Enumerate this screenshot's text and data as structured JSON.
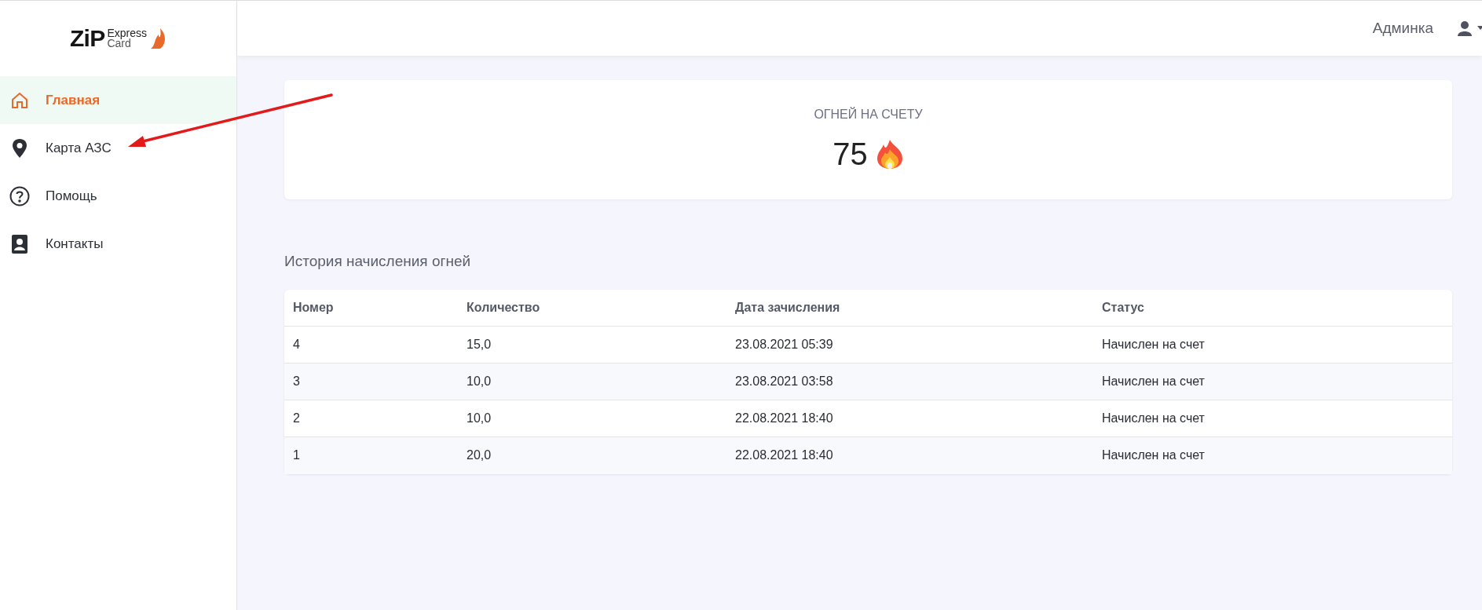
{
  "logo": {
    "brand": "ZiP",
    "line_1": "Express",
    "line_2": "Card"
  },
  "sidebar": {
    "items": [
      {
        "kind": "home",
        "label": "Главная",
        "selected": true
      },
      {
        "kind": "pin",
        "label": "Карта АЗС",
        "selected": false
      },
      {
        "kind": "help",
        "label": "Помощь",
        "selected": false
      },
      {
        "kind": "contact",
        "label": "Контакты",
        "selected": false
      }
    ]
  },
  "header": {
    "user": "Админка"
  },
  "balance": {
    "title": "ОГНЕЙ НА СЧЕТУ",
    "value": "75"
  },
  "history": {
    "title": "История начисления огней",
    "columns": [
      "Номер",
      "Количество",
      "Дата зачисления",
      "Статус"
    ],
    "rows": [
      [
        "4",
        "15,0",
        "23.08.2021 05:39",
        "Начислен на счет"
      ],
      [
        "3",
        "10,0",
        "23.08.2021 03:58",
        "Начислен на счет"
      ],
      [
        "2",
        "10,0",
        "22.08.2021 18:40",
        "Начислен на счет"
      ],
      [
        "1",
        "20,0",
        "22.08.2021 18:40",
        "Начислен на счет"
      ]
    ]
  }
}
